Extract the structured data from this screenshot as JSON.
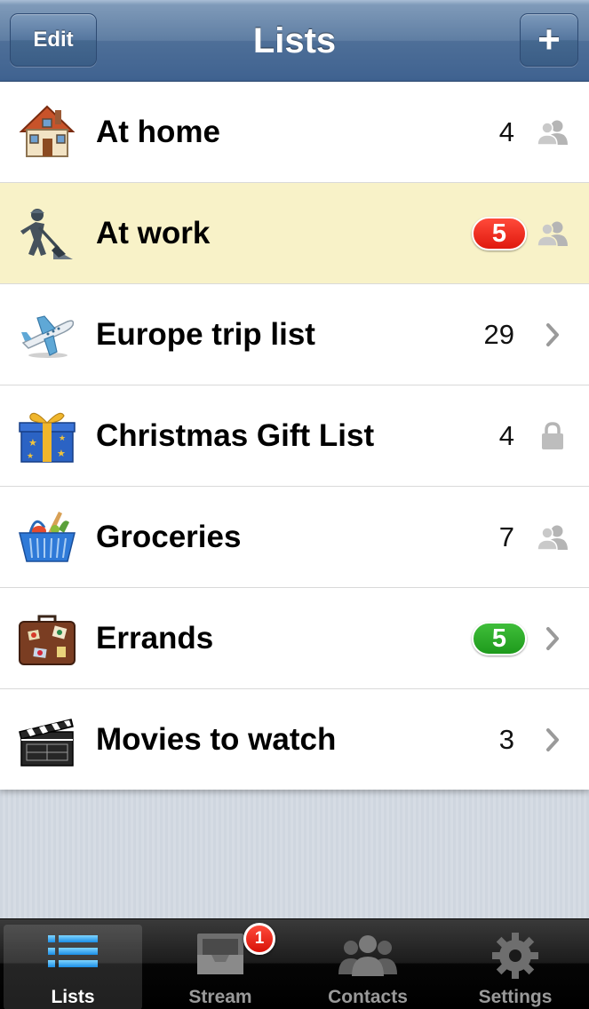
{
  "navbar": {
    "title": "Lists",
    "edit_label": "Edit",
    "add_label": "+"
  },
  "lists": [
    {
      "label": "At home",
      "count": "4",
      "icon": "house-icon",
      "accessory": "shared-people-icon",
      "badge": null
    },
    {
      "label": "At work",
      "count": "",
      "icon": "construction-worker-icon",
      "accessory": "shared-people-icon",
      "badge": {
        "value": "5",
        "color": "#e0190e"
      }
    },
    {
      "label": "Europe trip list",
      "count": "29",
      "icon": "airplane-icon",
      "accessory": "chevron-right-icon",
      "badge": null
    },
    {
      "label": "Christmas Gift List",
      "count": "4",
      "icon": "gift-box-icon",
      "accessory": "lock-icon",
      "badge": null
    },
    {
      "label": "Groceries",
      "count": "7",
      "icon": "grocery-basket-icon",
      "accessory": "shared-people-icon",
      "badge": null
    },
    {
      "label": "Errands",
      "count": "",
      "icon": "suitcase-icon",
      "accessory": "chevron-right-icon",
      "badge": {
        "value": "5",
        "color": "#1e9a1c"
      }
    },
    {
      "label": "Movies to watch",
      "count": "3",
      "icon": "clapperboard-icon",
      "accessory": "chevron-right-icon",
      "badge": null
    }
  ],
  "tabbar": {
    "tabs": [
      {
        "label": "Lists",
        "icon": "list-icon",
        "selected": true
      },
      {
        "label": "Stream",
        "icon": "inbox-tray-icon",
        "selected": false
      },
      {
        "label": "Contacts",
        "icon": "contacts-icon",
        "selected": false
      },
      {
        "label": "Settings",
        "icon": "gear-icon",
        "selected": false
      }
    ],
    "stream_badge": "1"
  },
  "colors": {
    "nav_blue": "#4e6f98",
    "highlight_row": "#f8f2c8",
    "badge_red": "#e0190e",
    "badge_green": "#1e9a1c"
  }
}
